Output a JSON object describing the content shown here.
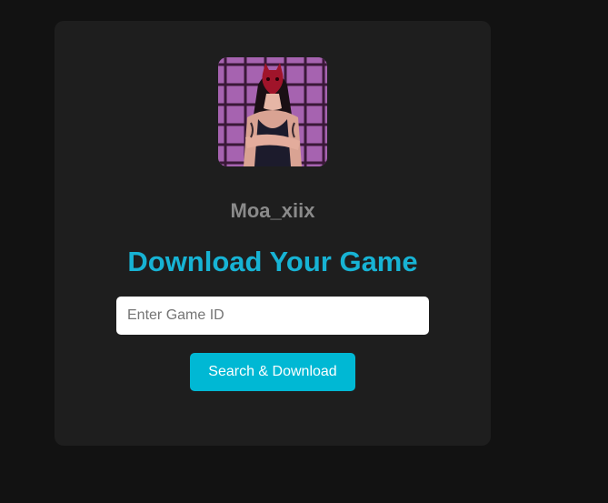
{
  "profile": {
    "username": "Moa_xiix",
    "avatar_alt": "profile-avatar"
  },
  "main": {
    "title": "Download Your Game"
  },
  "search": {
    "placeholder": "Enter Game ID",
    "value": "",
    "button_label": "Search & Download"
  },
  "colors": {
    "page_background": "#121212",
    "card_background": "#1e1e1e",
    "accent": "#17b3d4",
    "button": "#00b8d4",
    "username": "#8a8a8a"
  }
}
